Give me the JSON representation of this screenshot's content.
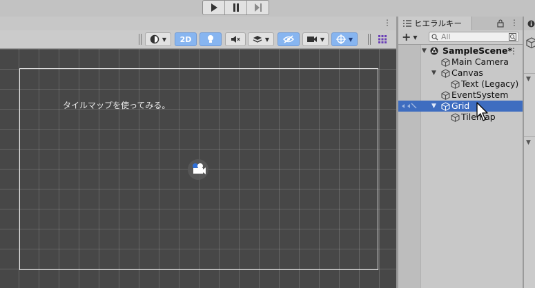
{
  "toolbar": {
    "play_icon": "play-icon",
    "pause_icon": "pause-icon",
    "step_icon": "step-icon"
  },
  "scene_toolbar": {
    "btn_2d": "2D",
    "icons": [
      "shading-mode-icon",
      "lighting-icon",
      "audio-mute-icon",
      "effects-icon",
      "scene-visibility-icon",
      "camera-icon",
      "gizmos-icon",
      "grid-icon"
    ]
  },
  "scene": {
    "text": "タイルマップを使ってみる。",
    "grid_color": "#474747"
  },
  "hierarchy": {
    "tab_label": "ヒエラルキー",
    "add_label": "+",
    "search_placeholder": "All",
    "rows": [
      {
        "label": "SampleScene*",
        "kind": "scene"
      },
      {
        "label": "Main Camera",
        "kind": "object"
      },
      {
        "label": "Canvas",
        "kind": "object"
      },
      {
        "label": "Text (Legacy)",
        "kind": "object"
      },
      {
        "label": "EventSystem",
        "kind": "object"
      },
      {
        "label": "Grid",
        "kind": "object",
        "selected": true
      },
      {
        "label": "Tilemap",
        "kind": "object"
      }
    ]
  },
  "colors": {
    "selection": "#3e6dc0",
    "toggle_on": "#87b5f0"
  }
}
